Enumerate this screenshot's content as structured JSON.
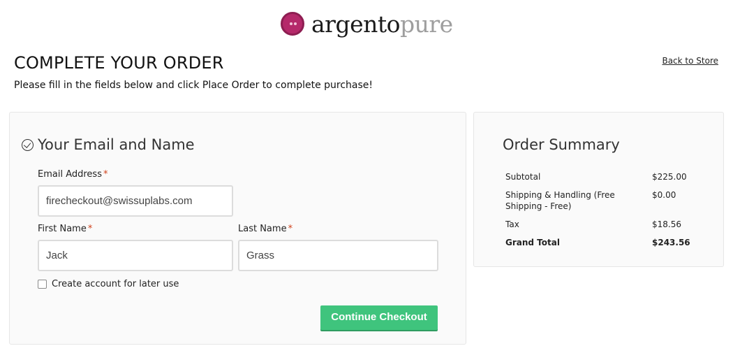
{
  "brand": {
    "name_a": "argento",
    "name_b": "pure"
  },
  "header": {
    "title": "COMPLETE YOUR ORDER",
    "subtitle": "Please fill in the fields below and click Place Order to complete purchase!",
    "back_link": "Back to Store"
  },
  "form": {
    "section_title": "Your Email and Name",
    "email_label": "Email Address",
    "email_value": "firecheckout@swissuplabs.com",
    "first_name_label": "First Name",
    "first_name_value": "Jack",
    "last_name_label": "Last Name",
    "last_name_value": "Grass",
    "required_mark": "*",
    "create_account_label": "Create account for later use",
    "create_account_checked": false,
    "continue_button": "Continue Checkout"
  },
  "summary": {
    "title": "Order Summary",
    "rows": [
      {
        "label": "Subtotal",
        "value": "$225.00"
      },
      {
        "label": "Shipping & Handling (Free Shipping - Free)",
        "value": "$0.00"
      },
      {
        "label": "Tax",
        "value": "$18.56"
      },
      {
        "label": "Grand Total",
        "value": "$243.56"
      }
    ]
  },
  "colors": {
    "accent": "#3fc47d",
    "brand": "#b5296a",
    "required": "#d0421b"
  }
}
